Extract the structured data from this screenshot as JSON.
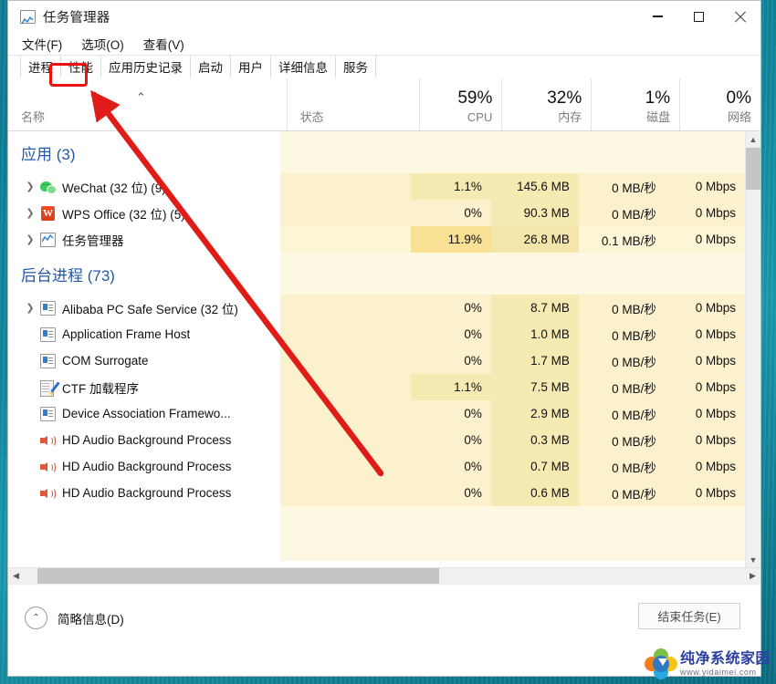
{
  "window": {
    "title": "任务管理器",
    "icon": "task-manager-chart-icon",
    "buttons": {
      "minimize": "—",
      "maximize": "□",
      "close": "✕"
    }
  },
  "menu": {
    "items": [
      "文件(F)",
      "选项(O)",
      "查看(V)"
    ]
  },
  "tabs": {
    "items": [
      "进程",
      "性能",
      "应用历史记录",
      "启动",
      "用户",
      "详细信息",
      "服务"
    ],
    "active": "进程",
    "highlighted": "性能",
    "highlight_color": "#ee1111"
  },
  "columns": {
    "name": {
      "header": "名称",
      "value": "",
      "sorted": "asc",
      "sort_glyph": "⌃"
    },
    "status": {
      "header": "状态",
      "value": ""
    },
    "cpu": {
      "header": "CPU",
      "value": "59%"
    },
    "memory": {
      "header": "内存",
      "value": "32%"
    },
    "disk": {
      "header": "磁盘",
      "value": "1%"
    },
    "network": {
      "header": "网络",
      "value": "0%"
    }
  },
  "groups": [
    {
      "label": "应用 (3)",
      "count": 3
    },
    {
      "label": "后台进程 (73)",
      "count": 73
    }
  ],
  "rows": [
    {
      "kind": "group",
      "name": "应用 (3)"
    },
    {
      "kind": "proc",
      "icon": "wechat-icon",
      "expandable": true,
      "name": "WeChat (32 位) (9)",
      "status": "",
      "cpu": "1.1%",
      "memory": "145.6 MB",
      "disk": "0 MB/秒",
      "network": "0 Mbps",
      "heat": "mid"
    },
    {
      "kind": "proc",
      "icon": "wps-icon",
      "expandable": true,
      "name": "WPS Office (32 位) (5)",
      "status": "",
      "cpu": "0%",
      "memory": "90.3 MB",
      "disk": "0 MB/秒",
      "network": "0 Mbps",
      "heat": "low"
    },
    {
      "kind": "proc",
      "icon": "task-manager-icon",
      "expandable": true,
      "name": "任务管理器",
      "status": "",
      "cpu": "11.9%",
      "memory": "26.8 MB",
      "disk": "0.1 MB/秒",
      "network": "0 Mbps",
      "heat": "high"
    },
    {
      "kind": "group",
      "name": "后台进程 (73)"
    },
    {
      "kind": "proc",
      "icon": "window-icon",
      "expandable": true,
      "name": "Alibaba PC Safe Service (32 位)",
      "status": "",
      "cpu": "0%",
      "memory": "8.7 MB",
      "disk": "0 MB/秒",
      "network": "0 Mbps",
      "heat": "low"
    },
    {
      "kind": "proc",
      "icon": "window-icon",
      "expandable": false,
      "name": "Application Frame Host",
      "status": "",
      "cpu": "0%",
      "memory": "1.0 MB",
      "disk": "0 MB/秒",
      "network": "0 Mbps",
      "heat": "low"
    },
    {
      "kind": "proc",
      "icon": "window-icon",
      "expandable": false,
      "name": "COM Surrogate",
      "status": "",
      "cpu": "0%",
      "memory": "1.7 MB",
      "disk": "0 MB/秒",
      "network": "0 Mbps",
      "heat": "low"
    },
    {
      "kind": "proc",
      "icon": "ctf-loader-icon",
      "expandable": false,
      "name": "CTF 加载程序",
      "status": "",
      "cpu": "1.1%",
      "memory": "7.5 MB",
      "disk": "0 MB/秒",
      "network": "0 Mbps",
      "heat": "mid"
    },
    {
      "kind": "proc",
      "icon": "window-icon",
      "expandable": false,
      "name": "Device Association Framewo...",
      "status": "",
      "cpu": "0%",
      "memory": "2.9 MB",
      "disk": "0 MB/秒",
      "network": "0 Mbps",
      "heat": "low"
    },
    {
      "kind": "proc",
      "icon": "speaker-icon",
      "expandable": false,
      "name": "HD Audio Background Process",
      "status": "",
      "cpu": "0%",
      "memory": "0.3 MB",
      "disk": "0 MB/秒",
      "network": "0 Mbps",
      "heat": "low"
    },
    {
      "kind": "proc",
      "icon": "speaker-icon",
      "expandable": false,
      "name": "HD Audio Background Process",
      "status": "",
      "cpu": "0%",
      "memory": "0.7 MB",
      "disk": "0 MB/秒",
      "network": "0 Mbps",
      "heat": "low"
    },
    {
      "kind": "proc",
      "icon": "speaker-icon",
      "expandable": false,
      "name": "HD Audio Background Process",
      "status": "",
      "cpu": "0%",
      "memory": "0.6 MB",
      "disk": "0 MB/秒",
      "network": "0 Mbps",
      "heat": "low"
    }
  ],
  "footer": {
    "fewer_details": "简略信息(D)",
    "fewer_glyph": "⌃",
    "end_task": "结束任务(E)"
  },
  "watermark": {
    "title": "纯净系统家园",
    "url": "www.yidaimei.com"
  },
  "colors": {
    "accent_group": "#2357a8",
    "heat_low": "#fbf2cd",
    "heat_mid": "#f6e7ad",
    "heat_high": "#f8e094",
    "band": "#fdf8e2",
    "annotation": "#e01c18",
    "desktop": "#10899c"
  }
}
